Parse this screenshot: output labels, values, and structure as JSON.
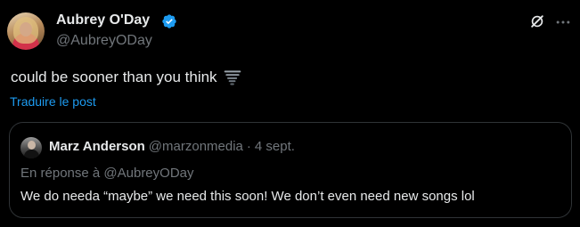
{
  "tweet": {
    "author": {
      "name": "Aubrey O'Day",
      "handle": "@AubreyODay",
      "verified": true,
      "verified_color": "#1d9bf0"
    },
    "text": "could be sooner than you think",
    "emoji_icon": "tornado-icon",
    "translate_label": "Traduire le post",
    "actions": {
      "grok_icon": "grok-icon",
      "more_icon": "more-icon"
    }
  },
  "quote": {
    "author_name": "Marz Anderson",
    "author_handle": "@marzonmedia",
    "separator": "·",
    "date": "4 sept.",
    "reply_context": "En réponse à @AubreyODay",
    "text": "We do needa “maybe” we need this soon! We don’t even need new songs lol"
  },
  "colors": {
    "background": "#000000",
    "primary_text": "#e7e9ea",
    "secondary_text": "#71767b",
    "link": "#1d9bf0",
    "border": "#2f3336"
  }
}
